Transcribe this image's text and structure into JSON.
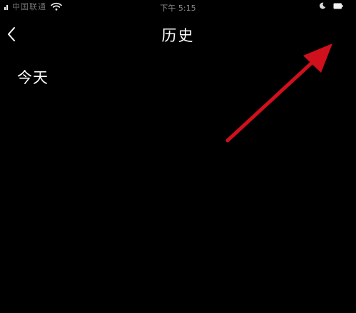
{
  "status_bar": {
    "carrier": "中国联通",
    "time": "下午 5:15",
    "signal_icon": "signal-bars-icon",
    "wifi_icon": "wifi-icon",
    "moon_icon": "do-not-disturb-moon-icon",
    "battery_icon": "battery-icon"
  },
  "nav_bar": {
    "back_icon": "chevron-left-icon",
    "title": "历史"
  },
  "history": {
    "section_label": "今天",
    "items": []
  },
  "annotation": {
    "type": "arrow",
    "color": "#d0101c",
    "points_to": "top-right corner"
  },
  "colors": {
    "background": "#000000",
    "text": "#ffffff",
    "muted_text": "#8a8a8a"
  }
}
